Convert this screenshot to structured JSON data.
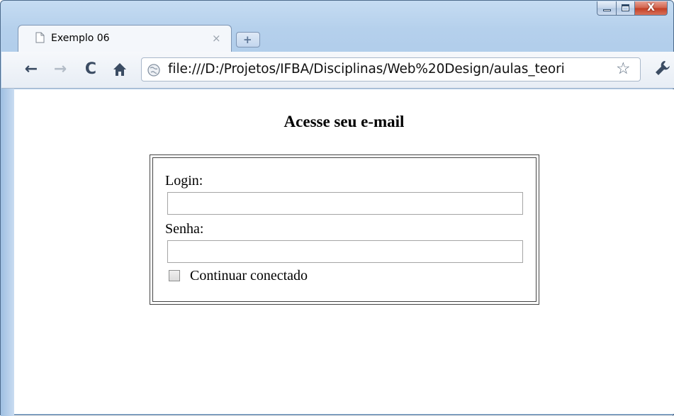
{
  "window": {
    "caption_buttons": [
      "minimize",
      "maximize",
      "close"
    ],
    "close_glyph": "X"
  },
  "tab": {
    "title": "Exemplo 06",
    "close_glyph": "×",
    "icon": "page-icon"
  },
  "new_tab": {
    "glyph": "+"
  },
  "toolbar": {
    "back_glyph": "←",
    "forward_glyph": "→",
    "reload_glyph": "C",
    "home_glyph": "⌂",
    "url": "file:///D:/Projetos/IFBA/Disciplinas/Web%20Design/aulas_teori",
    "bookmark_glyph": "☆"
  },
  "page": {
    "heading": "Acesse seu e-mail",
    "login_label": "Login:",
    "login_value": "",
    "senha_label": "Senha:",
    "senha_value": "",
    "remember_label": "Continuar conectado",
    "remember_checked": false
  },
  "colors": {
    "frame": "#b5d0ec",
    "close_button": "#c23d24"
  }
}
